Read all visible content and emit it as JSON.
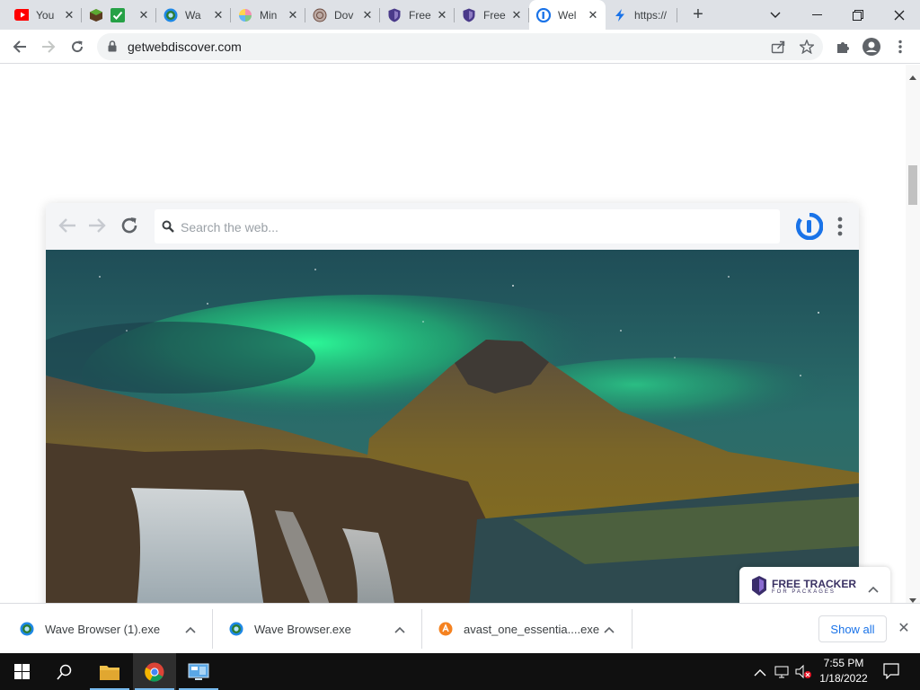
{
  "tabs": [
    {
      "label": "You",
      "icon": "youtube-icon"
    },
    {
      "label": "",
      "icon": "minecraft-icon"
    },
    {
      "label": "Wa",
      "icon": "wave-icon"
    },
    {
      "label": "Min",
      "icon": "pinwheel-icon"
    },
    {
      "label": "Dov",
      "icon": "globe-icon"
    },
    {
      "label": "Free",
      "icon": "shield-icon"
    },
    {
      "label": "Free",
      "icon": "shield-icon"
    },
    {
      "label": "Wel",
      "icon": "webdiscover-icon",
      "active": true
    },
    {
      "label": "https://",
      "icon": "bolt-icon"
    }
  ],
  "address_bar": {
    "url": "getwebdiscover.com"
  },
  "mock_browser": {
    "search_placeholder": "Search the web..."
  },
  "promo": {
    "title": "FREE TRACKER",
    "subtitle": "FOR PACKAGES"
  },
  "downloads": {
    "items": [
      {
        "name": "Wave Browser (1).exe",
        "icon": "wave-icon"
      },
      {
        "name": "Wave Browser.exe",
        "icon": "wave-icon"
      },
      {
        "name": "avast_one_essentia....exe",
        "icon": "avast-icon"
      }
    ],
    "show_all": "Show all"
  },
  "taskbar": {
    "time": "7:55 PM",
    "date": "1/18/2022"
  },
  "colors": {
    "tabstrip": "#dee1e6",
    "accent": "#1a73e8",
    "taskbar": "#101010"
  }
}
